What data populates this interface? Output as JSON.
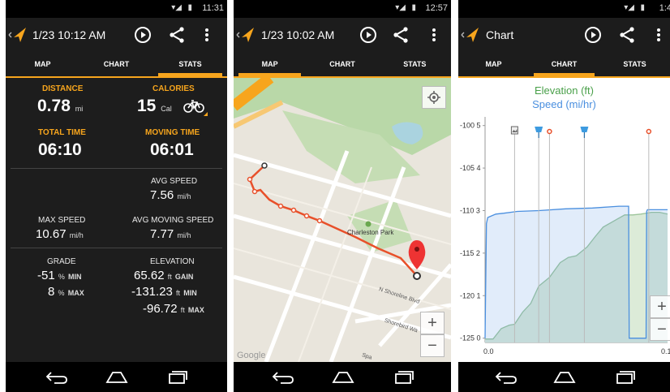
{
  "status": {
    "time1": "11:31",
    "time2": "12:57",
    "time3": "1:4"
  },
  "screen1": {
    "title": "1/23 10:12 AM",
    "tabs": [
      "MAP",
      "CHART",
      "STATS"
    ],
    "stats": {
      "distance_label": "DISTANCE",
      "distance_value": "0.78",
      "distance_unit": "mi",
      "calories_label": "CALORIES",
      "calories_value": "15",
      "calories_unit": "Cal",
      "total_time_label": "TOTAL TIME",
      "total_time_value": "06:10",
      "moving_time_label": "MOVING TIME",
      "moving_time_value": "06:01",
      "avg_speed_label": "AVG SPEED",
      "avg_speed_value": "7.56",
      "avg_speed_unit": "mi/h",
      "max_speed_label": "MAX SPEED",
      "max_speed_value": "10.67",
      "max_speed_unit": "mi/h",
      "avg_moving_speed_label": "AVG MOVING SPEED",
      "avg_moving_speed_value": "7.77",
      "avg_moving_speed_unit": "mi/h",
      "grade_label": "GRADE",
      "grade_min_value": "-51",
      "grade_min_unit": "%",
      "grade_min_tag": "MIN",
      "grade_max_value": "8",
      "grade_max_unit": "%",
      "grade_max_tag": "MAX",
      "elevation_label": "ELEVATION",
      "elev_gain_value": "65.62",
      "elev_gain_unit": "ft",
      "elev_gain_tag": "GAIN",
      "elev_min_value": "-131.23",
      "elev_min_unit": "ft",
      "elev_min_tag": "MIN",
      "elev_max_value": "-96.72",
      "elev_max_unit": "ft",
      "elev_max_tag": "MAX"
    }
  },
  "screen2": {
    "title": "1/23 10:02 AM",
    "tabs": [
      "MAP",
      "CHART",
      "STATS"
    ],
    "map": {
      "park_label": "Charleston Park",
      "street1": "N Shoreline Blvd",
      "street2": "Shorebird Wa",
      "street3": "Spa",
      "watermark": "Google",
      "zoom_in": "+",
      "zoom_out": "−"
    }
  },
  "screen3": {
    "title": "Chart",
    "tabs": [
      "MAP",
      "CHART",
      "STATS"
    ],
    "chart_legend_elevation": "Elevation (ft)",
    "chart_legend_speed": "Speed (mi/hr)",
    "zoom_in": "+",
    "zoom_out": "−"
  },
  "colors": {
    "accent": "#f7a51d",
    "elevation": "#c8dfc8",
    "speed": "#4a8fdf"
  },
  "chart_data": {
    "type": "area",
    "series": [
      {
        "name": "Elevation (ft)",
        "x": [
          0.0,
          0.003,
          0.006,
          0.009,
          0.011,
          0.014,
          0.017,
          0.02,
          0.024,
          0.028,
          0.031,
          0.034,
          0.038,
          0.041,
          0.044,
          0.048,
          0.052,
          0.055,
          0.058,
          0.062,
          0.065,
          0.068
        ],
        "y": [
          -125.1,
          -125.1,
          -123.9,
          -123.5,
          -123.4,
          -122.0,
          -121.0,
          -119.0,
          -118.0,
          -116.3,
          -115.7,
          -115.5,
          -114.5,
          -113.3,
          -112.2,
          -111.5,
          -110.8,
          -110.8,
          -110.7,
          -110.5,
          -110.5,
          -110.7
        ]
      },
      {
        "name": "Speed (mi/hr)",
        "x": [
          0.0,
          0.0005,
          0.001,
          0.004,
          0.007,
          0.012,
          0.02,
          0.03,
          0.04,
          0.05,
          0.0535,
          0.0537,
          0.06,
          0.0602,
          0.0605,
          0.068
        ],
        "y": [
          -125.0,
          -111.8,
          -111.1,
          -110.7,
          -110.6,
          -110.4,
          -110.3,
          -110.1,
          -110.0,
          -109.8,
          -109.8,
          -125.0,
          -125.0,
          -110.4,
          -110.2,
          -110.2
        ]
      }
    ],
    "markers": [
      {
        "type": "photo",
        "x": 0.011
      },
      {
        "type": "pin",
        "x": 0.02
      },
      {
        "type": "dot",
        "x": 0.024
      },
      {
        "type": "pin",
        "x": 0.037
      },
      {
        "type": "dot",
        "x": 0.061
      }
    ],
    "xlim": [
      0.0,
      0.068
    ],
    "ylim": [
      -125.5,
      -99.5
    ],
    "x_ticks": [
      "0.0",
      "0.1"
    ],
    "y_ticks": [
      -100.5,
      -105.4,
      -110.3,
      -115.2,
      -120.1,
      -125.0
    ],
    "y_tick_labels": [
      "-100 5",
      "-105 4",
      "-110 3",
      "-115 2",
      "-120 1",
      "-125 0"
    ]
  }
}
